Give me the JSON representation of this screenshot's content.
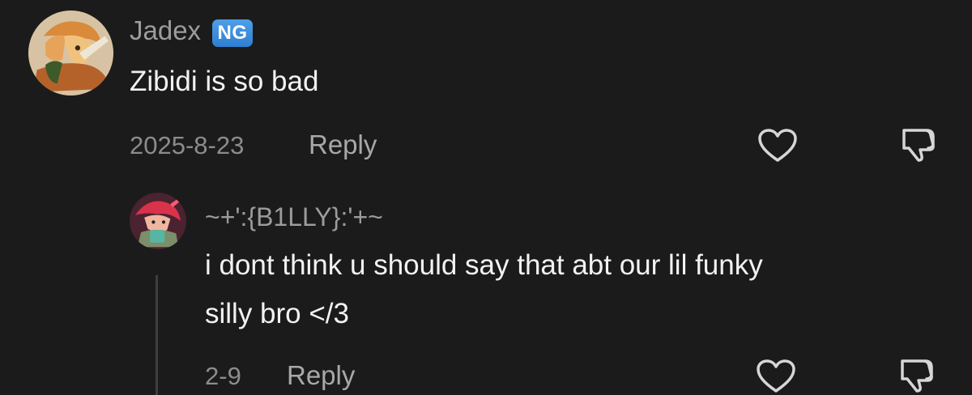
{
  "comment": {
    "username": "Jadex",
    "badge": "NG",
    "text": "Zibidi is so bad",
    "date": "2025-8-23",
    "reply_label": "Reply"
  },
  "reply": {
    "username": "~+':{B1LLY}:'+~",
    "text_line1": "i dont think u should say that abt our lil funky",
    "text_line2": "silly bro </3",
    "date": "2-9",
    "reply_label": "Reply"
  },
  "colors": {
    "background": "#1b1b1b",
    "badge": "#3f8fdf"
  },
  "icons": {
    "like": "heart-icon",
    "dislike": "thumbs-down-icon"
  }
}
